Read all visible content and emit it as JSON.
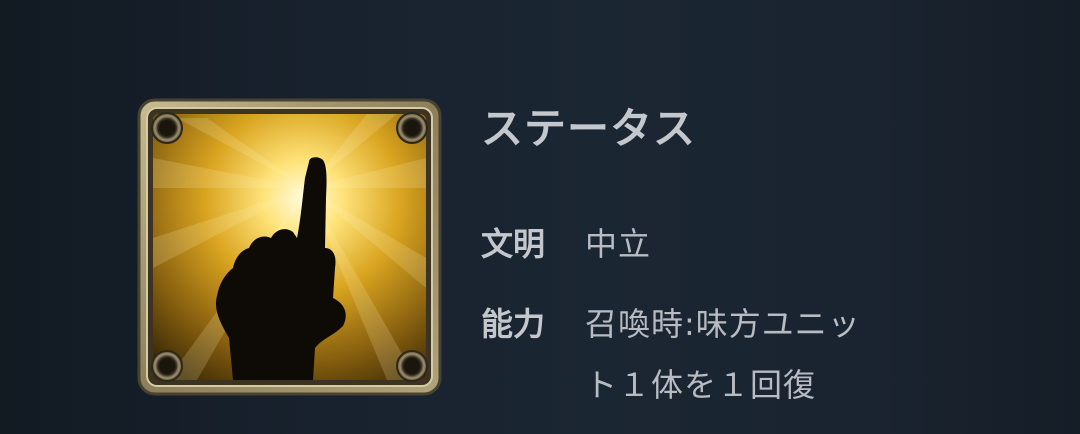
{
  "card": {
    "icon": "raised-index-finger-icon",
    "colors": {
      "glow": "#fff2a0",
      "glow_mid": "#e6b82a",
      "glow_edge": "#5a3e08",
      "frame": "#a89a72",
      "hand": "#0d0b08"
    }
  },
  "status": {
    "title": "ステータス",
    "civilization_label": "文明",
    "civilization_value": "中立",
    "ability_label": "能力",
    "ability_line1": "召喚時:味方ユニッ",
    "ability_line2": "ト１体を１回復"
  }
}
